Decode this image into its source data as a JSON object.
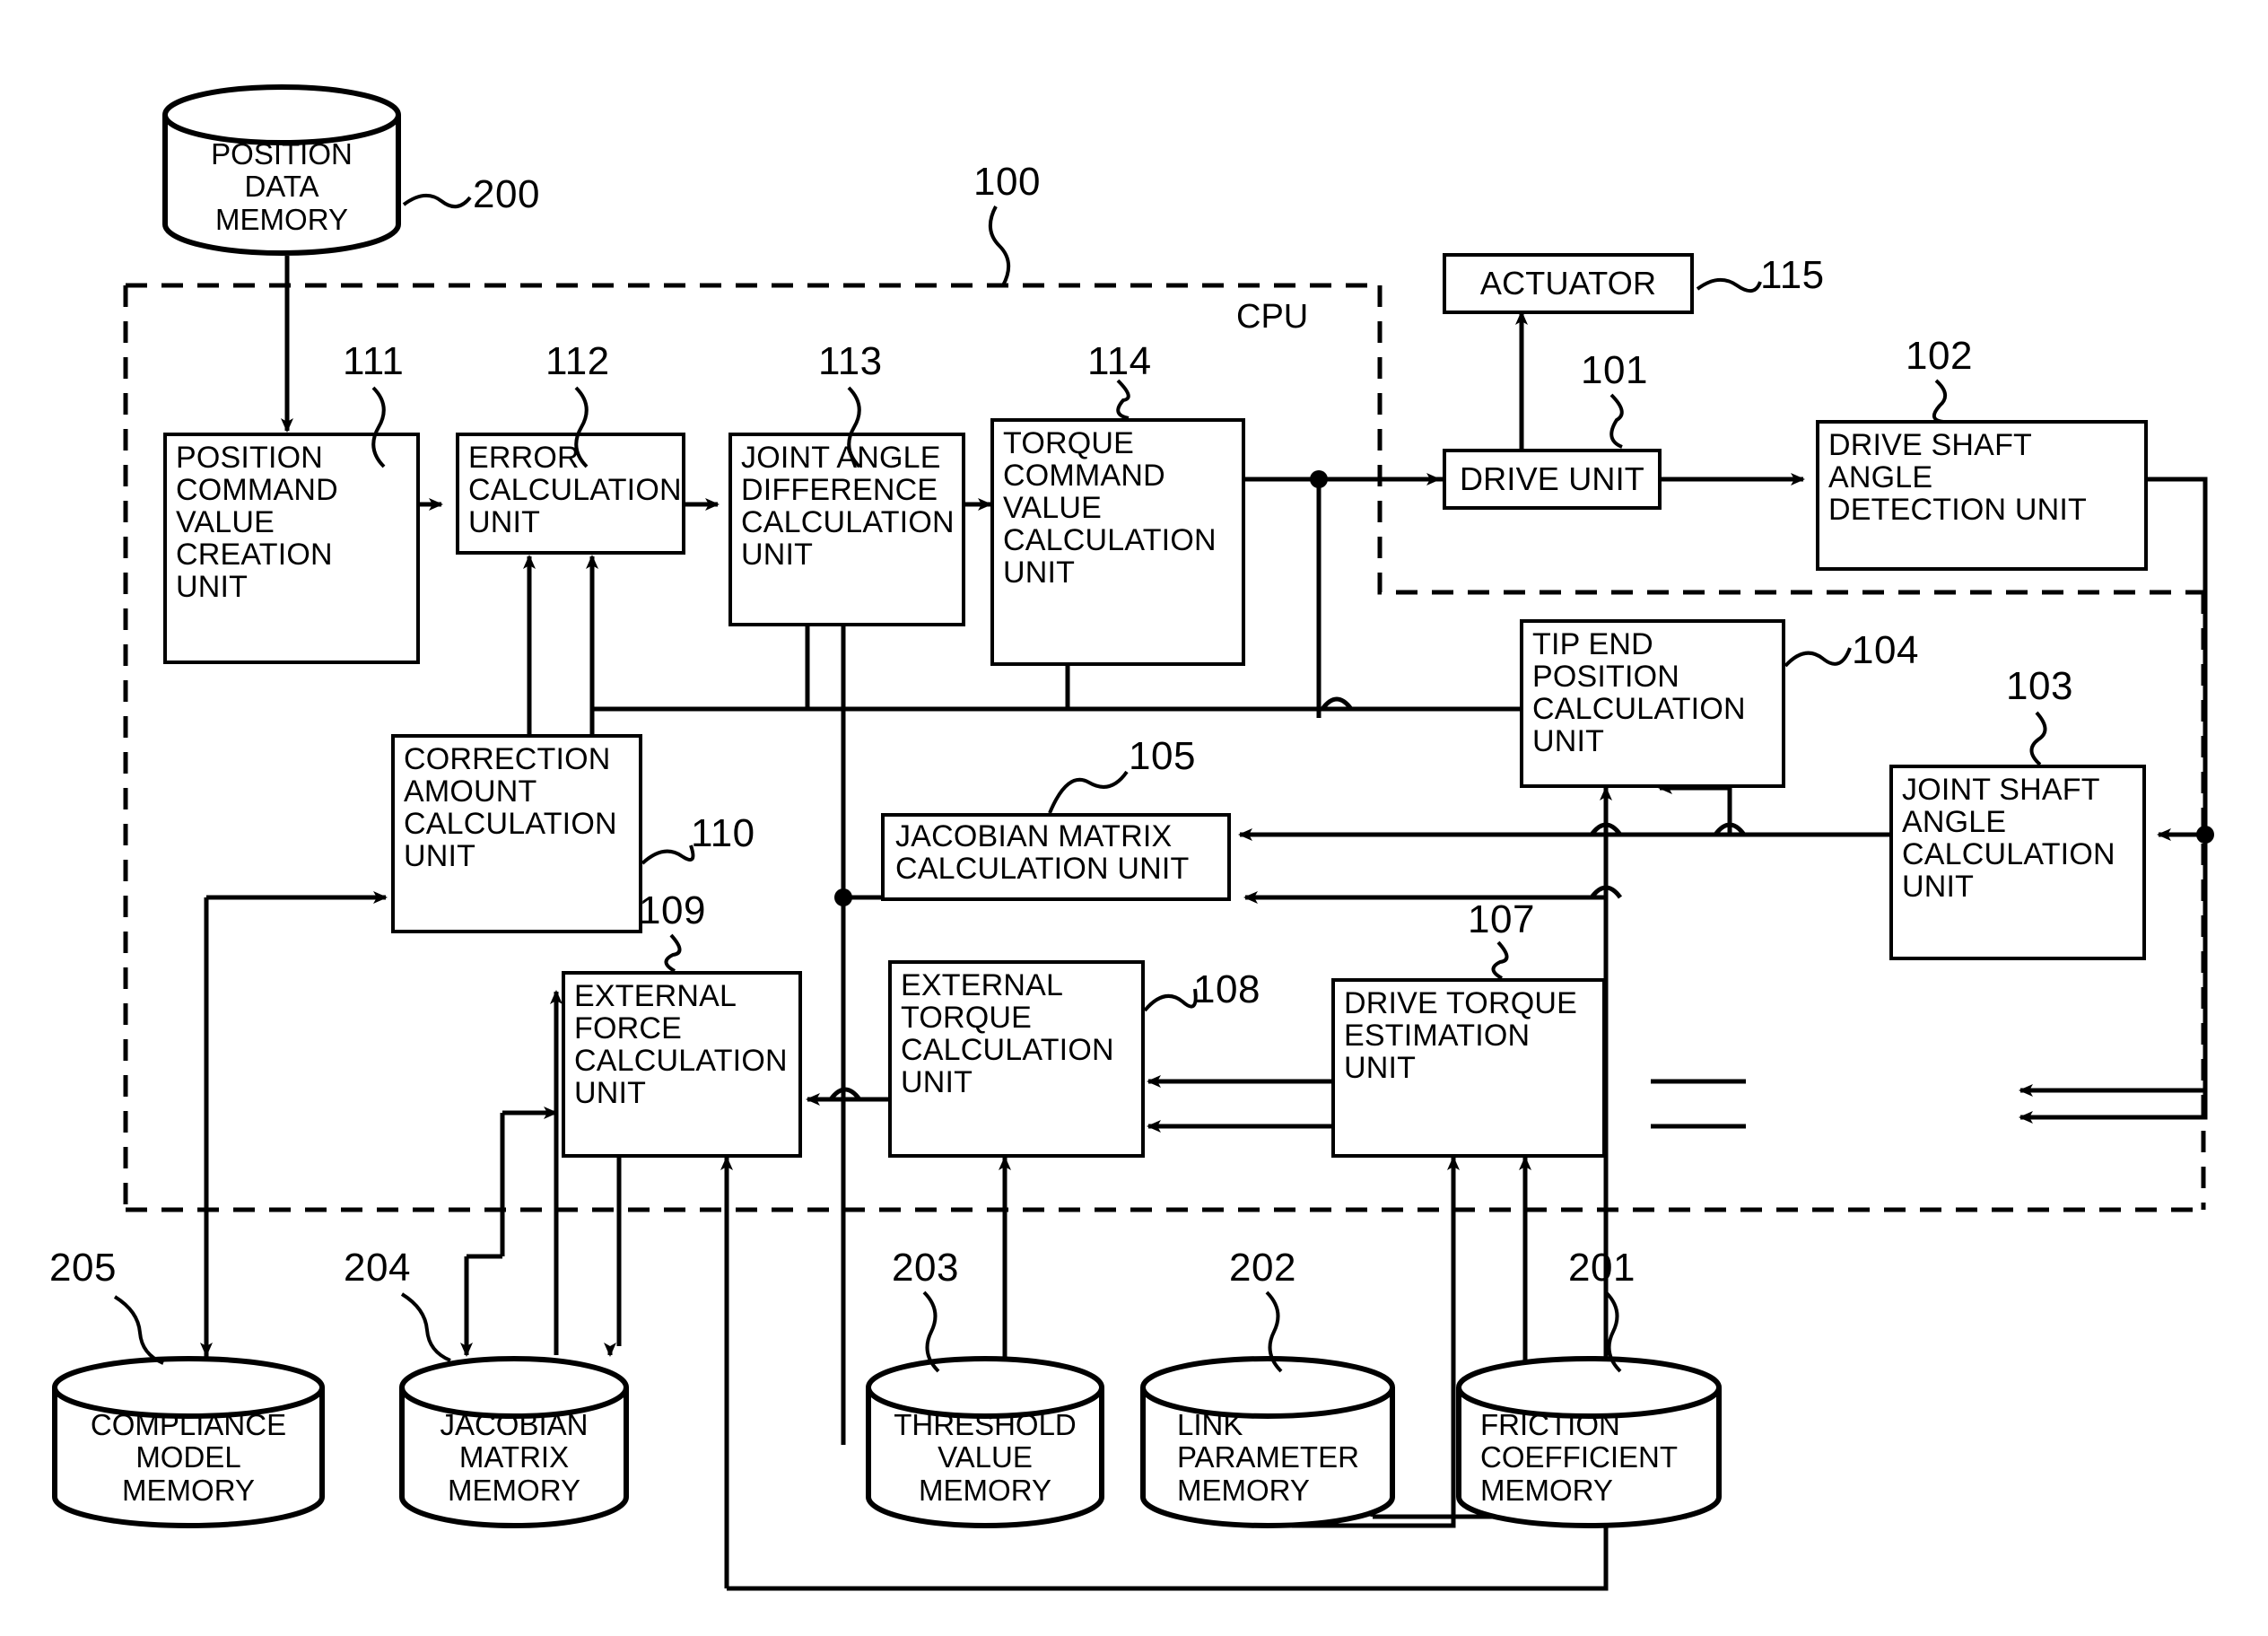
{
  "diagram": {
    "cpu_label": "CPU",
    "cpu_ref": "100",
    "units": [
      {
        "id": "111",
        "label": "POSITION\nCOMMAND\nVALUE\nCREATION\nUNIT"
      },
      {
        "id": "112",
        "label": "ERROR\nCALCULATION\nUNIT"
      },
      {
        "id": "113",
        "label": "JOINT ANGLE\nDIFFERENCE\nCALCULATION\nUNIT"
      },
      {
        "id": "114",
        "label": "TORQUE\nCOMMAND\nVALUE\nCALCULATION\nUNIT"
      },
      {
        "id": "115",
        "label": "ACTUATOR"
      },
      {
        "id": "101",
        "label": "DRIVE UNIT"
      },
      {
        "id": "102",
        "label": "DRIVE SHAFT\nANGLE\nDETECTION UNIT"
      },
      {
        "id": "103",
        "label": "JOINT SHAFT\nANGLE\nCALCULATION\nUNIT"
      },
      {
        "id": "104",
        "label": "TIP END\nPOSITION\nCALCULATION\nUNIT"
      },
      {
        "id": "105",
        "label": "JACOBIAN MATRIX\nCALCULATION UNIT"
      },
      {
        "id": "107",
        "label": "DRIVE TORQUE\nESTIMATION\nUNIT"
      },
      {
        "id": "108",
        "label": "EXTERNAL\nTORQUE\nCALCULATION\nUNIT"
      },
      {
        "id": "109",
        "label": "EXTERNAL\nFORCE\nCALCULATION\nUNIT"
      },
      {
        "id": "110",
        "label": "CORRECTION\nAMOUNT\nCALCULATION\nUNIT"
      }
    ],
    "memories": [
      {
        "id": "200",
        "label": "POSITION\nDATA\nMEMORY"
      },
      {
        "id": "201",
        "label": "FRICTION\nCOEFFICIENT\nMEMORY"
      },
      {
        "id": "202",
        "label": "LINK\nPARAMETER\nMEMORY"
      },
      {
        "id": "203",
        "label": "THRESHOLD\nVALUE\nMEMORY"
      },
      {
        "id": "204",
        "label": "JACOBIAN\nMATRIX\nMEMORY"
      },
      {
        "id": "205",
        "label": "COMPLIANCE\nMODEL\nMEMORY"
      }
    ]
  }
}
